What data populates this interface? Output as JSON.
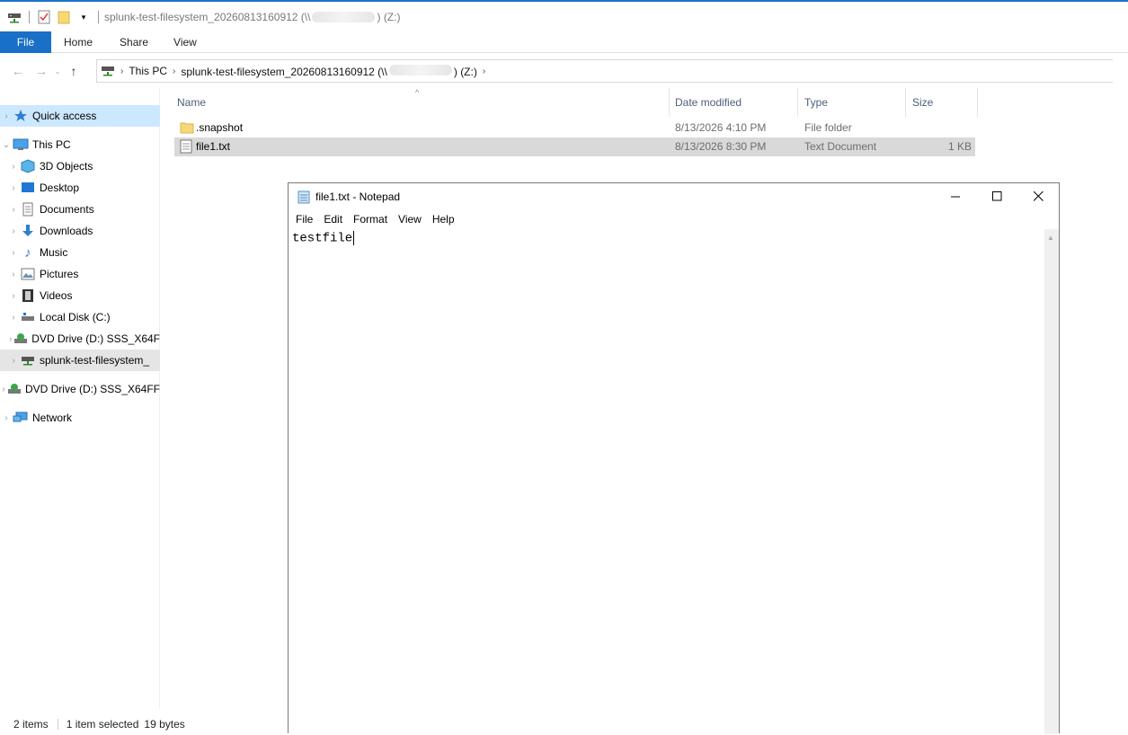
{
  "explorer": {
    "window_title_prefix": "splunk-test-filesystem_20260813160912 (\\\\",
    "window_title_suffix": ") (Z:)",
    "ribbon_tabs": [
      "File",
      "Home",
      "Share",
      "View"
    ],
    "address": {
      "crumbs": [
        "This PC",
        "splunk-test-filesystem_20260813160912 (\\\\"
      ],
      "crumb_suffix": ") (Z:)"
    },
    "nav": {
      "quick_access": "Quick access",
      "this_pc": "This PC",
      "items": [
        "3D Objects",
        "Desktop",
        "Documents",
        "Downloads",
        "Music",
        "Pictures",
        "Videos",
        "Local Disk (C:)",
        "DVD Drive (D:) SSS_X64F",
        "splunk-test-filesystem_"
      ],
      "dvd_drive": "DVD Drive (D:) SSS_X64FF",
      "network": "Network"
    },
    "columns": [
      "Name",
      "Date modified",
      "Type",
      "Size"
    ],
    "files": [
      {
        "name": ".snapshot",
        "date": "8/13/2026 4:10 PM",
        "type": "File folder",
        "size": "",
        "selected": false,
        "icon": "folder-icon"
      },
      {
        "name": "file1.txt",
        "date": "8/13/2026 8:30 PM",
        "type": "Text Document",
        "size": "1 KB",
        "selected": true,
        "icon": "text-file-icon"
      }
    ],
    "status": {
      "count": "2 items",
      "selection": "1 item selected",
      "bytes": "19 bytes"
    }
  },
  "notepad": {
    "title": "file1.txt - Notepad",
    "menu": [
      "File",
      "Edit",
      "Format",
      "View",
      "Help"
    ],
    "content": "testfile"
  },
  "colors": {
    "accent": "#1a6fc6",
    "selection_blue": "#cce8ff",
    "selection_gray": "#d9d9d9"
  }
}
